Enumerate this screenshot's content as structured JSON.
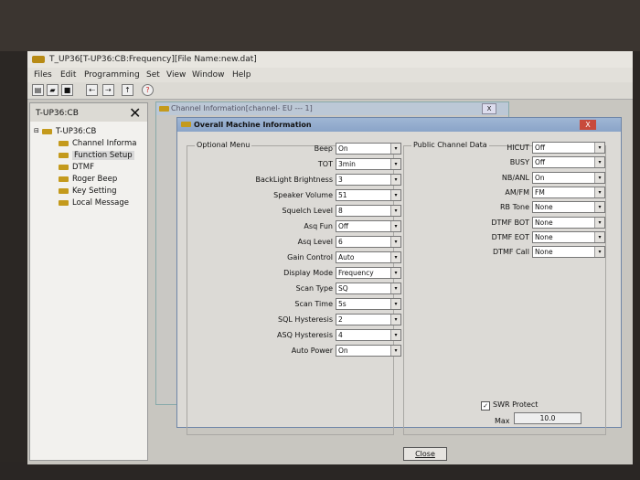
{
  "app": {
    "title": "T_UP36[T-UP36:CB:Frequency][File Name:new.dat]"
  },
  "menu": [
    "Files",
    "Edit",
    "Programming",
    "Set",
    "View",
    "Window",
    "Help"
  ],
  "toolbar": {
    "icons": [
      "new-file-icon",
      "open-folder-icon",
      "save-icon",
      "read-radio-icon",
      "write-radio-icon",
      "send-icon",
      "help-icon"
    ]
  },
  "tree": {
    "panel_title": "T-UP36:CB",
    "root": "T-UP36:CB",
    "items": [
      {
        "label": "Channel Informa"
      },
      {
        "label": "Function Setup",
        "selected": true
      },
      {
        "label": "DTMF"
      },
      {
        "label": "Roger Beep"
      },
      {
        "label": "Key Setting"
      },
      {
        "label": "Local Message"
      }
    ]
  },
  "child_window": {
    "title": "Channel Information[channel- EU --- 1]",
    "close_label": "X"
  },
  "dialog": {
    "title": "Overall Machine Information",
    "close_label": "X",
    "optional_menu": {
      "label": "Optional Menu",
      "rows": [
        {
          "label": "Beep",
          "value": "On"
        },
        {
          "label": "TOT",
          "value": "3min"
        },
        {
          "label": "BackLight Brightness",
          "value": "3"
        },
        {
          "label": "Speaker Volume",
          "value": "51"
        },
        {
          "label": "Squelch Level",
          "value": "8"
        },
        {
          "label": "Asq Fun",
          "value": "Off"
        },
        {
          "label": "Asq Level",
          "value": "6"
        },
        {
          "label": "Gain Control",
          "value": "Auto"
        },
        {
          "label": "Display Mode",
          "value": "Frequency"
        },
        {
          "label": "Scan Type",
          "value": "SQ"
        },
        {
          "label": "Scan Time",
          "value": "5s"
        },
        {
          "label": "SQL Hysteresis",
          "value": "2"
        },
        {
          "label": "ASQ Hysteresis",
          "value": "4"
        },
        {
          "label": "Auto Power",
          "value": "On"
        }
      ]
    },
    "public_channel": {
      "label": "Public Channel Data",
      "rows": [
        {
          "label": "HICUT",
          "value": "Off"
        },
        {
          "label": "BUSY",
          "value": "Off"
        },
        {
          "label": "NB/ANL",
          "value": "On"
        },
        {
          "label": "AM/FM",
          "value": "FM"
        },
        {
          "label": "RB Tone",
          "value": "None"
        },
        {
          "label": "DTMF BOT",
          "value": "None"
        },
        {
          "label": "DTMF EOT",
          "value": "None"
        },
        {
          "label": "DTMF Call",
          "value": "None"
        }
      ],
      "swr_protect": {
        "label": "SWR Protect",
        "checked": true
      },
      "max": {
        "label": "Max",
        "value": "10.0"
      }
    },
    "close_button": "Close"
  }
}
